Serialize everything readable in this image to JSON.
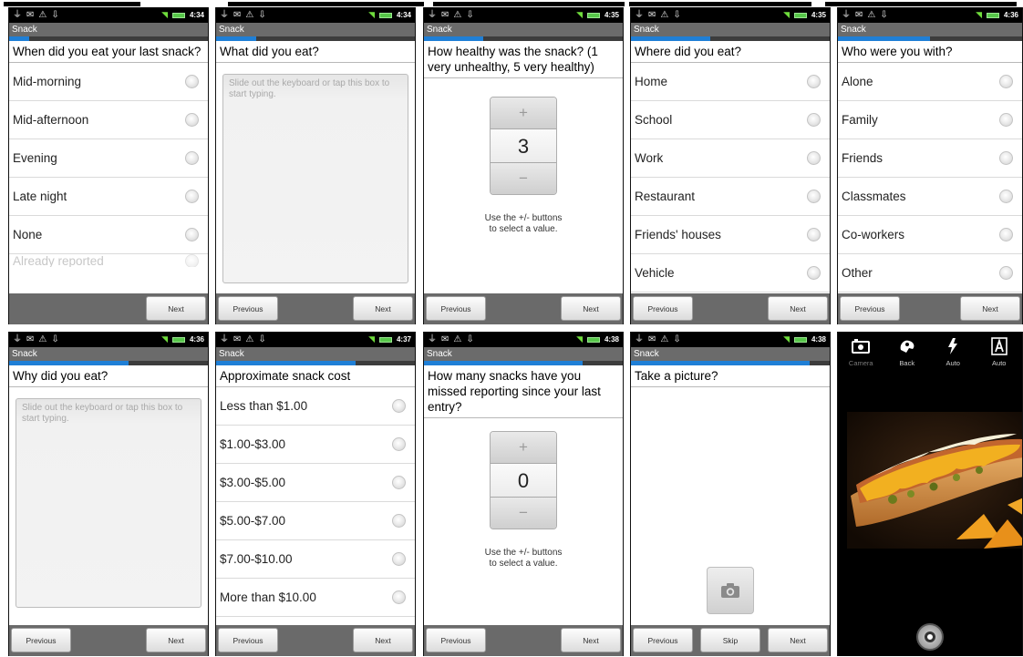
{
  "app_title": "Snack",
  "nav": {
    "previous": "Previous",
    "next": "Next",
    "skip": "Skip"
  },
  "status_times": [
    "4:34",
    "4:34",
    "4:35",
    "4:35",
    "4:36",
    "4:36",
    "4:37",
    "4:38",
    "4:38"
  ],
  "screens": {
    "last_snack": {
      "question": "When did you eat your last snack?",
      "options": [
        "Mid-morning",
        "Mid-afternoon",
        "Evening",
        "Late night",
        "None"
      ],
      "partial_option": "Already reported",
      "progress": 0.1
    },
    "what_eat": {
      "question": "What did you eat?",
      "placeholder": "Slide out the keyboard or tap this box to start typing.",
      "progress": 0.2
    },
    "healthy": {
      "question": "How healthy was the snack? (1 very unhealthy, 5 very healthy)",
      "value": "3",
      "hint_line1": "Use the +/- buttons",
      "hint_line2": "to select a value.",
      "progress": 0.3
    },
    "where_eat": {
      "question": "Where did you eat?",
      "options": [
        "Home",
        "School",
        "Work",
        "Restaurant",
        "Friends' houses",
        "Vehicle"
      ],
      "progress": 0.4
    },
    "who_with": {
      "question": "Who were you with?",
      "options": [
        "Alone",
        "Family",
        "Friends",
        "Classmates",
        "Co-workers",
        "Other"
      ],
      "progress": 0.5
    },
    "why_eat": {
      "question": "Why did you eat?",
      "placeholder": "Slide out the keyboard or tap this box to start typing.",
      "progress": 0.6
    },
    "cost": {
      "question": "Approximate snack cost",
      "options": [
        "Less than $1.00",
        "$1.00-$3.00",
        "$3.00-$5.00",
        "$5.00-$7.00",
        "$7.00-$10.00",
        "More than $10.00"
      ],
      "progress": 0.7
    },
    "missed": {
      "question": "How many snacks have you missed reporting since your last entry?",
      "value": "0",
      "hint_line1": "Use the +/- buttons",
      "hint_line2": "to select a value.",
      "progress": 0.8
    },
    "picture": {
      "question": "Take a picture?",
      "progress": 0.9
    },
    "camera": {
      "items": [
        {
          "label": "Camera",
          "icon": "camera-icon"
        },
        {
          "label": "Back",
          "icon": "back-icon"
        },
        {
          "label": "Auto",
          "icon": "flash-auto-icon"
        },
        {
          "label": "Auto",
          "icon": "auto-mode-icon"
        }
      ]
    }
  },
  "colors": {
    "title_bar": "#6b6b6b",
    "progress": "#1f7fd6",
    "nav_bar": "#6a6a6a"
  }
}
